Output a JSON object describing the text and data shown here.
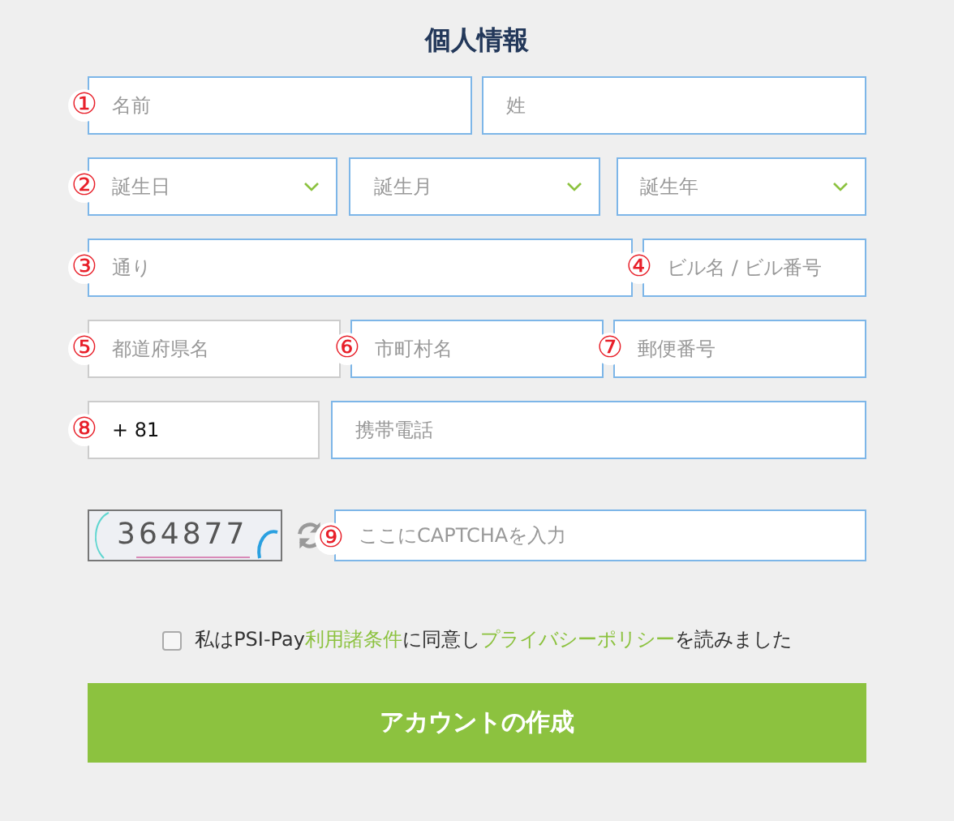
{
  "title": "個人情報",
  "rows": [
    {
      "fields": [
        {
          "kind": "text",
          "placeholder": "名前",
          "marker": "①",
          "highlighted": true
        },
        {
          "kind": "text",
          "placeholder": "姓",
          "highlighted": true
        }
      ]
    },
    {
      "fields": [
        {
          "kind": "select",
          "placeholder": "誕生日",
          "marker": "②",
          "highlighted": true
        },
        {
          "kind": "select",
          "placeholder": "誕生月",
          "highlighted": true
        },
        {
          "kind": "select",
          "placeholder": "誕生年",
          "highlighted": true
        }
      ]
    },
    {
      "fields": [
        {
          "kind": "text",
          "placeholder": "通り",
          "marker": "③",
          "highlighted": true
        },
        {
          "kind": "text",
          "placeholder": "ビル名 / ビル番号",
          "marker": "④",
          "highlighted": true
        }
      ]
    },
    {
      "fields": [
        {
          "kind": "text",
          "placeholder": "都道府県名",
          "marker": "⑤",
          "highlighted": false
        },
        {
          "kind": "text",
          "placeholder": "市町村名",
          "marker": "⑥",
          "highlighted": true
        },
        {
          "kind": "text",
          "placeholder": "郵便番号",
          "marker": "⑦",
          "highlighted": true
        }
      ]
    },
    {
      "fields": [
        {
          "kind": "text",
          "value": "+ 81",
          "marker": "⑧",
          "highlighted": false
        },
        {
          "kind": "text",
          "placeholder": "携帯電話",
          "highlighted": true
        }
      ]
    }
  ],
  "captcha": {
    "code": "364877",
    "field": {
      "placeholder": "ここにCAPTCHAを入力",
      "marker": "⑨",
      "highlighted": true
    }
  },
  "agreement": {
    "checked": false,
    "parts": [
      {
        "kind": "text",
        "text": "私はPSI-Pay"
      },
      {
        "kind": "link",
        "text": "利用諸条件"
      },
      {
        "kind": "text",
        "text": "に同意し"
      },
      {
        "kind": "link",
        "text": "プライバシーポリシー"
      },
      {
        "kind": "text",
        "text": "を読みました"
      }
    ]
  },
  "submit": "アカウントの作成"
}
